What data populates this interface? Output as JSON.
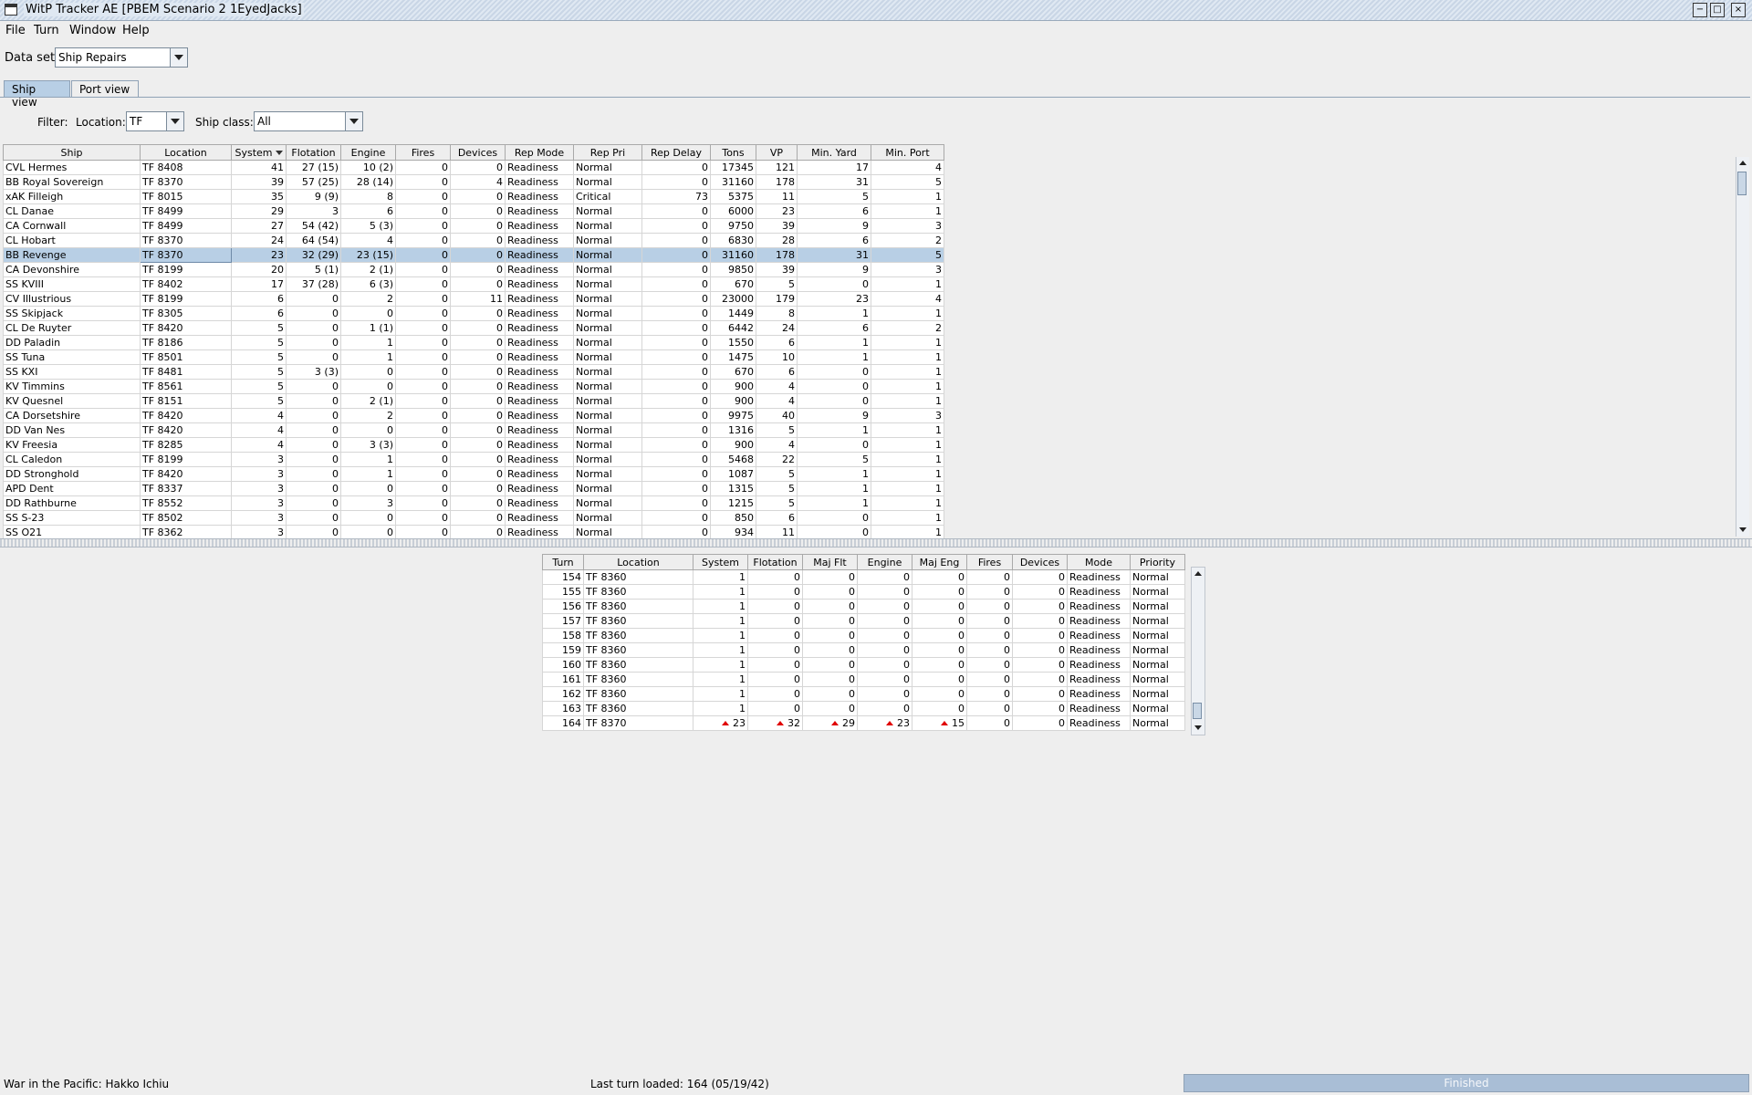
{
  "window": {
    "title": "WitP Tracker AE [PBEM Scenario 2 1EyedJacks]",
    "controls": [
      "minimize-icon",
      "maximize-icon",
      "close-icon"
    ]
  },
  "menubar": {
    "items": [
      {
        "label": "File"
      },
      {
        "label": "Turn"
      },
      {
        "label": "Window"
      },
      {
        "label": "Help"
      }
    ]
  },
  "dataset": {
    "label": "Data set:",
    "value": "Ship Repairs"
  },
  "tabs": [
    {
      "label": "Ship view",
      "active": true
    },
    {
      "label": "Port view",
      "active": false
    }
  ],
  "filter": {
    "label": "Filter:",
    "location_label": "Location:",
    "location_value": "TF",
    "shipclass_label": "Ship class:",
    "shipclass_value": "All"
  },
  "ship_table": {
    "columns": [
      "Ship",
      "Location",
      "System",
      "Flotation",
      "Engine",
      "Fires",
      "Devices",
      "Rep Mode",
      "Rep Pri",
      "Rep Delay",
      "Tons",
      "VP",
      "Min. Yard",
      "Min. Port"
    ],
    "sorted_column": "System",
    "selected_row": 6,
    "rows": [
      [
        "CVL Hermes",
        "TF 8408",
        "41",
        "27 (15)",
        "10 (2)",
        "0",
        "0",
        "Readiness",
        "Normal",
        "0",
        "17345",
        "121",
        "17",
        "4"
      ],
      [
        "BB Royal Sovereign",
        "TF 8370",
        "39",
        "57 (25)",
        "28 (14)",
        "0",
        "4",
        "Readiness",
        "Normal",
        "0",
        "31160",
        "178",
        "31",
        "5"
      ],
      [
        "xAK Filleigh",
        "TF 8015",
        "35",
        "9 (9)",
        "8",
        "0",
        "0",
        "Readiness",
        "Critical",
        "73",
        "5375",
        "11",
        "5",
        "1"
      ],
      [
        "CL Danae",
        "TF 8499",
        "29",
        "3",
        "6",
        "0",
        "0",
        "Readiness",
        "Normal",
        "0",
        "6000",
        "23",
        "6",
        "1"
      ],
      [
        "CA Cornwall",
        "TF 8499",
        "27",
        "54 (42)",
        "5 (3)",
        "0",
        "0",
        "Readiness",
        "Normal",
        "0",
        "9750",
        "39",
        "9",
        "3"
      ],
      [
        "CL Hobart",
        "TF 8370",
        "24",
        "64 (54)",
        "4",
        "0",
        "0",
        "Readiness",
        "Normal",
        "0",
        "6830",
        "28",
        "6",
        "2"
      ],
      [
        "BB Revenge",
        "TF 8370",
        "23",
        "32 (29)",
        "23 (15)",
        "0",
        "0",
        "Readiness",
        "Normal",
        "0",
        "31160",
        "178",
        "31",
        "5"
      ],
      [
        "CA Devonshire",
        "TF 8199",
        "20",
        "5 (1)",
        "2 (1)",
        "0",
        "0",
        "Readiness",
        "Normal",
        "0",
        "9850",
        "39",
        "9",
        "3"
      ],
      [
        "SS KVIII",
        "TF 8402",
        "17",
        "37 (28)",
        "6 (3)",
        "0",
        "0",
        "Readiness",
        "Normal",
        "0",
        "670",
        "5",
        "0",
        "1"
      ],
      [
        "CV Illustrious",
        "TF 8199",
        "6",
        "0",
        "2",
        "0",
        "11",
        "Readiness",
        "Normal",
        "0",
        "23000",
        "179",
        "23",
        "4"
      ],
      [
        "SS Skipjack",
        "TF 8305",
        "6",
        "0",
        "0",
        "0",
        "0",
        "Readiness",
        "Normal",
        "0",
        "1449",
        "8",
        "1",
        "1"
      ],
      [
        "CL De Ruyter",
        "TF 8420",
        "5",
        "0",
        "1 (1)",
        "0",
        "0",
        "Readiness",
        "Normal",
        "0",
        "6442",
        "24",
        "6",
        "2"
      ],
      [
        "DD Paladin",
        "TF 8186",
        "5",
        "0",
        "1",
        "0",
        "0",
        "Readiness",
        "Normal",
        "0",
        "1550",
        "6",
        "1",
        "1"
      ],
      [
        "SS Tuna",
        "TF 8501",
        "5",
        "0",
        "1",
        "0",
        "0",
        "Readiness",
        "Normal",
        "0",
        "1475",
        "10",
        "1",
        "1"
      ],
      [
        "SS KXI",
        "TF 8481",
        "5",
        "3 (3)",
        "0",
        "0",
        "0",
        "Readiness",
        "Normal",
        "0",
        "670",
        "6",
        "0",
        "1"
      ],
      [
        "KV Timmins",
        "TF 8561",
        "5",
        "0",
        "0",
        "0",
        "0",
        "Readiness",
        "Normal",
        "0",
        "900",
        "4",
        "0",
        "1"
      ],
      [
        "KV Quesnel",
        "TF 8151",
        "5",
        "0",
        "2 (1)",
        "0",
        "0",
        "Readiness",
        "Normal",
        "0",
        "900",
        "4",
        "0",
        "1"
      ],
      [
        "CA Dorsetshire",
        "TF 8420",
        "4",
        "0",
        "2",
        "0",
        "0",
        "Readiness",
        "Normal",
        "0",
        "9975",
        "40",
        "9",
        "3"
      ],
      [
        "DD Van Nes",
        "TF 8420",
        "4",
        "0",
        "0",
        "0",
        "0",
        "Readiness",
        "Normal",
        "0",
        "1316",
        "5",
        "1",
        "1"
      ],
      [
        "KV Freesia",
        "TF 8285",
        "4",
        "0",
        "3 (3)",
        "0",
        "0",
        "Readiness",
        "Normal",
        "0",
        "900",
        "4",
        "0",
        "1"
      ],
      [
        "CL Caledon",
        "TF 8199",
        "3",
        "0",
        "1",
        "0",
        "0",
        "Readiness",
        "Normal",
        "0",
        "5468",
        "22",
        "5",
        "1"
      ],
      [
        "DD Stronghold",
        "TF 8420",
        "3",
        "0",
        "1",
        "0",
        "0",
        "Readiness",
        "Normal",
        "0",
        "1087",
        "5",
        "1",
        "1"
      ],
      [
        "APD Dent",
        "TF 8337",
        "3",
        "0",
        "0",
        "0",
        "0",
        "Readiness",
        "Normal",
        "0",
        "1315",
        "5",
        "1",
        "1"
      ],
      [
        "DD Rathburne",
        "TF 8552",
        "3",
        "0",
        "3",
        "0",
        "0",
        "Readiness",
        "Normal",
        "0",
        "1215",
        "5",
        "1",
        "1"
      ],
      [
        "SS S-23",
        "TF 8502",
        "3",
        "0",
        "0",
        "0",
        "0",
        "Readiness",
        "Normal",
        "0",
        "850",
        "6",
        "0",
        "1"
      ],
      [
        "SS O21",
        "TF 8362",
        "3",
        "0",
        "0",
        "0",
        "0",
        "Readiness",
        "Normal",
        "0",
        "934",
        "11",
        "0",
        "1"
      ]
    ]
  },
  "history_table": {
    "columns": [
      "Turn",
      "Location",
      "System",
      "Flotation",
      "Maj Flt",
      "Engine",
      "Maj Eng",
      "Fires",
      "Devices",
      "Mode",
      "Priority"
    ],
    "rows": [
      [
        "154",
        "TF 8360",
        "1",
        "0",
        "0",
        "0",
        "0",
        "0",
        "0",
        "Readiness",
        "Normal"
      ],
      [
        "155",
        "TF 8360",
        "1",
        "0",
        "0",
        "0",
        "0",
        "0",
        "0",
        "Readiness",
        "Normal"
      ],
      [
        "156",
        "TF 8360",
        "1",
        "0",
        "0",
        "0",
        "0",
        "0",
        "0",
        "Readiness",
        "Normal"
      ],
      [
        "157",
        "TF 8360",
        "1",
        "0",
        "0",
        "0",
        "0",
        "0",
        "0",
        "Readiness",
        "Normal"
      ],
      [
        "158",
        "TF 8360",
        "1",
        "0",
        "0",
        "0",
        "0",
        "0",
        "0",
        "Readiness",
        "Normal"
      ],
      [
        "159",
        "TF 8360",
        "1",
        "0",
        "0",
        "0",
        "0",
        "0",
        "0",
        "Readiness",
        "Normal"
      ],
      [
        "160",
        "TF 8360",
        "1",
        "0",
        "0",
        "0",
        "0",
        "0",
        "0",
        "Readiness",
        "Normal"
      ],
      [
        "161",
        "TF 8360",
        "1",
        "0",
        "0",
        "0",
        "0",
        "0",
        "0",
        "Readiness",
        "Normal"
      ],
      [
        "162",
        "TF 8360",
        "1",
        "0",
        "0",
        "0",
        "0",
        "0",
        "0",
        "Readiness",
        "Normal"
      ],
      [
        "163",
        "TF 8360",
        "1",
        "0",
        "0",
        "0",
        "0",
        "0",
        "0",
        "Readiness",
        "Normal"
      ],
      [
        "164",
        "TF 8370",
        "23",
        "32",
        "29",
        "23",
        "15",
        "0",
        "0",
        "Readiness",
        "Normal"
      ]
    ],
    "increase_markers_row": 10,
    "increase_markers_cols": [
      2,
      3,
      4,
      5,
      6
    ]
  },
  "status": {
    "left": "War in the Pacific: Hakko Ichiu",
    "middle": "Last turn loaded: 164 (05/19/42)",
    "progress_label": "Finished",
    "progress_value": 1.0
  },
  "colors": {
    "selection": "#b8cfe5",
    "increase_marker": "#e00000",
    "progress_fill": "#a9bed6"
  }
}
